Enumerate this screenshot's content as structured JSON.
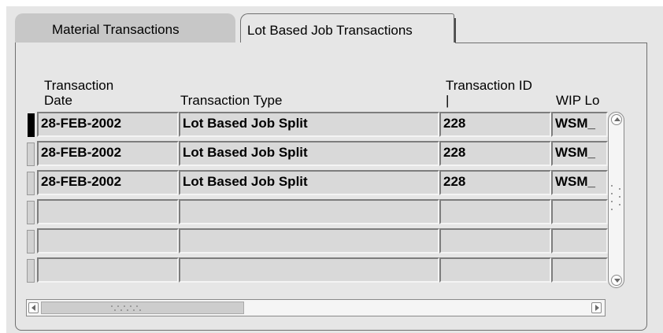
{
  "tabs": [
    {
      "label": "Material Transactions",
      "active": false
    },
    {
      "label": "Lot Based Job Transactions",
      "active": true
    }
  ],
  "columns": {
    "transaction_date": "Transaction\nDate",
    "transaction_type": "Transaction Type",
    "transaction_id": "Transaction ID\n|",
    "wip_lot": "WIP Lo"
  },
  "rows": [
    {
      "date": "28-FEB-2002",
      "type": "Lot Based Job Split",
      "id": "228",
      "wip": "WSM_"
    },
    {
      "date": "28-FEB-2002",
      "type": "Lot Based Job Split",
      "id": "228",
      "wip": "WSM_"
    },
    {
      "date": "28-FEB-2002",
      "type": "Lot Based Job Split",
      "id": "228",
      "wip": "WSM_"
    },
    {
      "date": "",
      "type": "",
      "id": "",
      "wip": ""
    },
    {
      "date": "",
      "type": "",
      "id": "",
      "wip": ""
    },
    {
      "date": "",
      "type": "",
      "id": "",
      "wip": ""
    }
  ],
  "colors": {
    "background": "#e6e6e6",
    "cell": "#d9d9d9",
    "tab_inactive": "#c7c7c7"
  }
}
